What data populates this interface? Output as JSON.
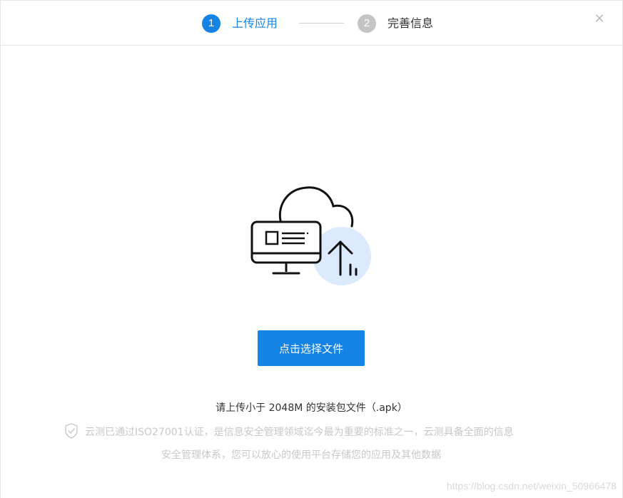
{
  "steps": [
    {
      "number": "1",
      "label": "上传应用",
      "state": "active"
    },
    {
      "number": "2",
      "label": "完善信息",
      "state": "pending"
    }
  ],
  "close_icon": "close-icon",
  "close_glyph": "×",
  "upload": {
    "button_label": "点击选择文件",
    "hint": "请上传小于 2048M 的安装包文件（.apk）"
  },
  "security": {
    "icon": "shield-check-icon",
    "line1": "云测已通过ISO27001认证，是信息安全管理领域迄今最为重要的标准之一，云测具备全面的信息",
    "line2": "安全管理体系，您可以放心的使用平台存储您的应用及其他数据"
  },
  "watermark": "https://blog.csdn.net/weixin_50966478",
  "colors": {
    "accent": "#1483e3",
    "inactive_step": "#c4c4c4",
    "muted_text": "#c8c8c8",
    "illustration_circle": "#dbeafd"
  }
}
